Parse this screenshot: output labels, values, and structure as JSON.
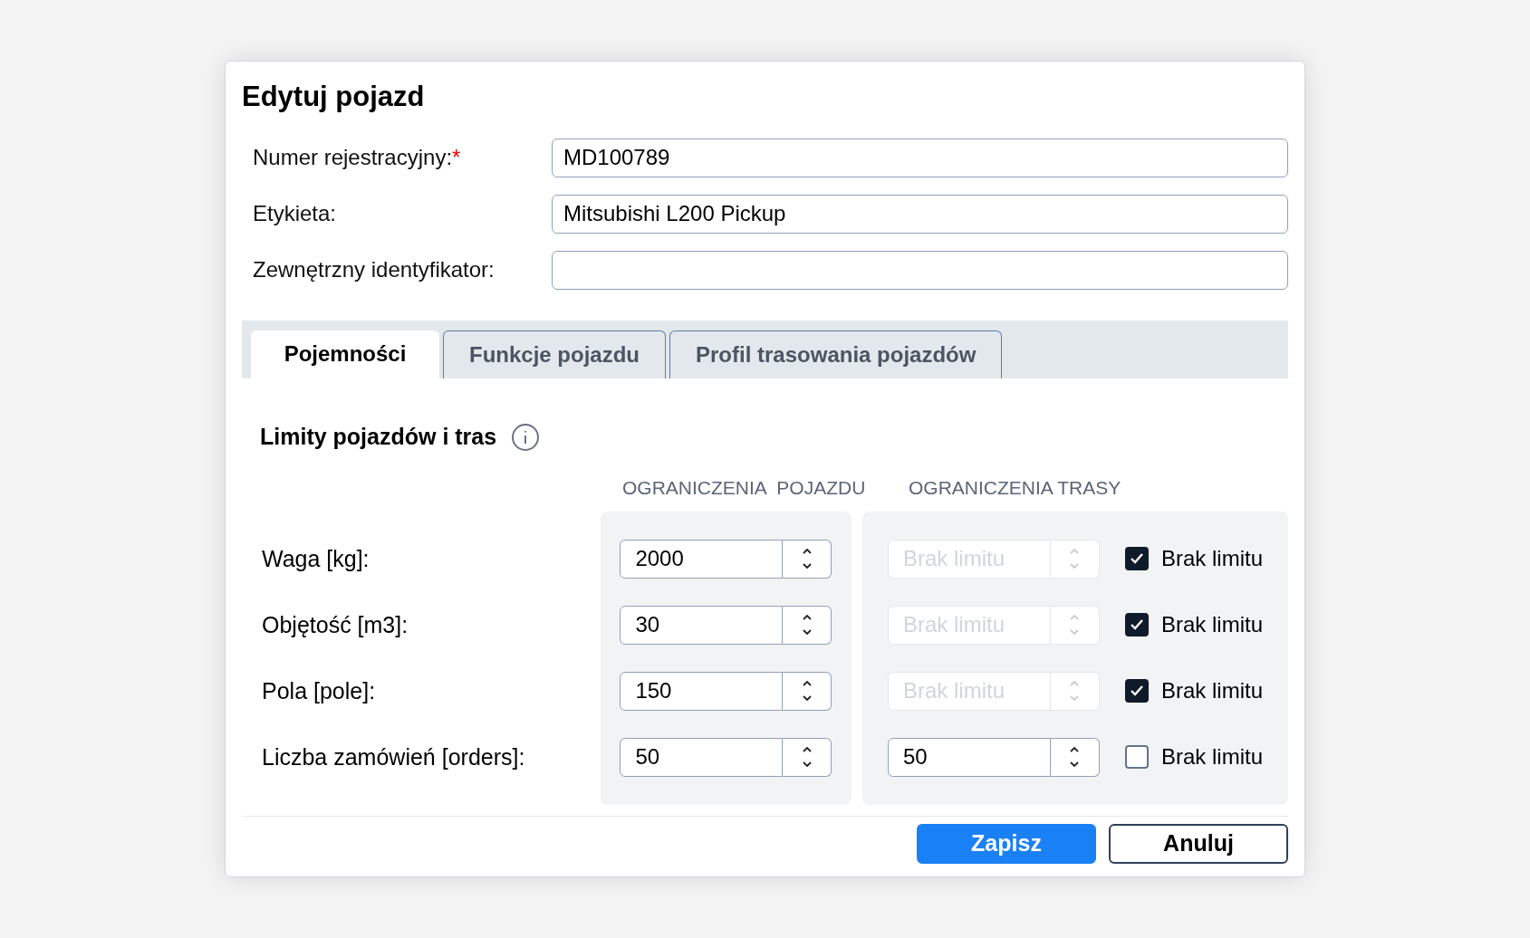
{
  "dialog": {
    "title": "Edytuj pojazd"
  },
  "fields": [
    {
      "label": "Numer rejestracyjny:",
      "required": true,
      "value": "MD100789"
    },
    {
      "label": "Etykieta:",
      "required": false,
      "value": "Mitsubishi L200 Pickup"
    },
    {
      "label": "Zewnętrzny identyfikator:",
      "required": false
    }
  ],
  "required_mark": "*",
  "tabs": [
    {
      "label": "Pojemności",
      "selected": true
    },
    {
      "label": "Funkcje pojazdu",
      "selected": false
    },
    {
      "label": "Profil trasowania pojazdów",
      "selected": false
    }
  ],
  "limits": {
    "title": "Limity pojazdów i tras",
    "vehicle_header": "OGRANICZENIA  POJAZDU",
    "route_header": "OGRANICZENIA TRASY",
    "rows": [
      {
        "label": "Waga [kg]:",
        "vehicle_value": "2000",
        "route": {
          "placeholder": "Brak limitu"
        },
        "no_limit": {
          "label": "Brak limitu",
          "checked": true
        }
      },
      {
        "label": "Objętość [m3]:",
        "vehicle_value": "30",
        "route": {
          "placeholder": "Brak limitu"
        },
        "no_limit": {
          "label": "Brak limitu",
          "checked": true
        }
      },
      {
        "label": "Pola [pole]:",
        "vehicle_value": "150",
        "route": {
          "placeholder": "Brak limitu"
        },
        "no_limit": {
          "label": "Brak limitu",
          "checked": true
        }
      },
      {
        "label": "Liczba zamówień [orders]:",
        "vehicle_value": "50",
        "route": {
          "value": "50"
        },
        "no_limit": {
          "label": "Brak limitu",
          "checked": false
        }
      }
    ]
  },
  "buttons": [
    {
      "label": "Zapisz",
      "kind": "primary"
    },
    {
      "label": "Anuluj",
      "kind": "secondary"
    }
  ]
}
